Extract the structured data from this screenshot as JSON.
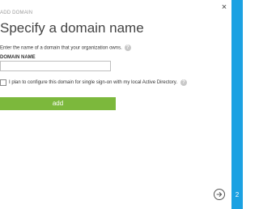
{
  "dialog": {
    "header_label": "ADD DOMAIN",
    "close_glyph": "×",
    "title": "Specify a domain name",
    "instruction": "Enter the name of a domain that your organization owns.",
    "help_glyph": "?",
    "field_label": "DOMAIN NAME",
    "domain_value": "",
    "sso_checkbox_checked": false,
    "sso_label": "I plan to configure this domain for single sign-on with my local Active Directory.",
    "add_button_label": "add"
  },
  "side_panel": {
    "step_number": "2"
  },
  "colors": {
    "accent_blue": "#1ba1e2",
    "button_green": "#7cb83c",
    "help_icon_gray": "#c8c8c8"
  },
  "icons": {
    "close": "close-icon",
    "help": "help-icon",
    "next": "arrow-right-icon"
  }
}
